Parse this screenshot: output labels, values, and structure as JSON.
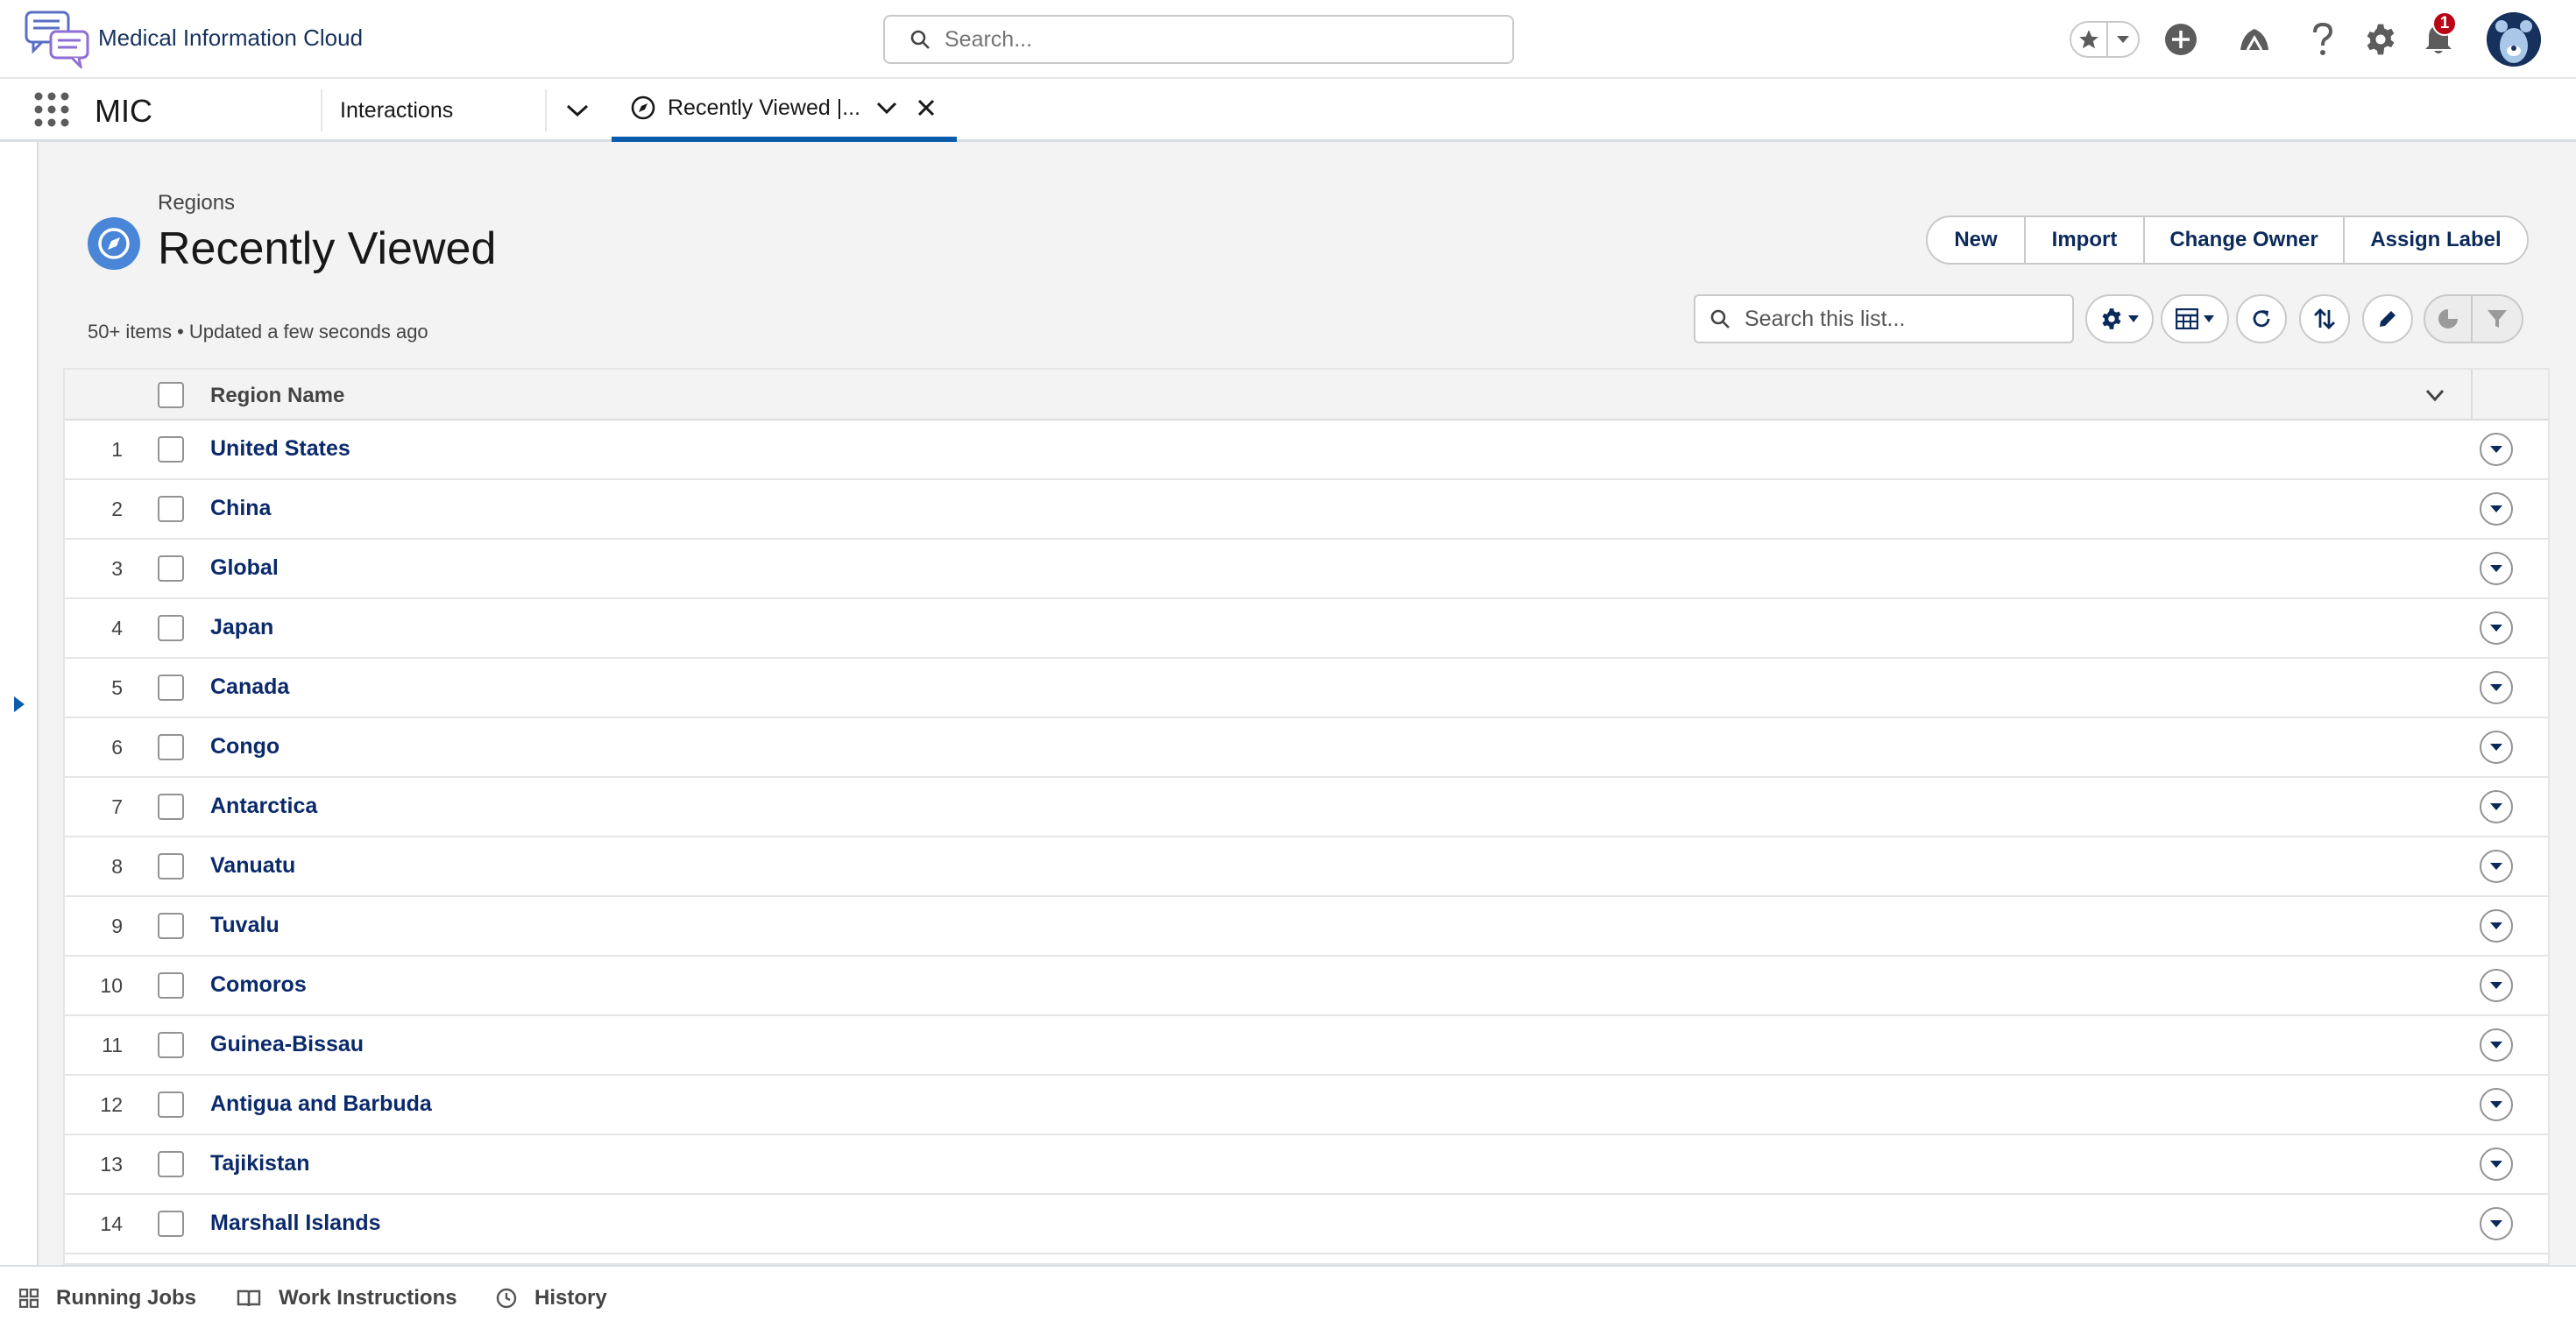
{
  "header": {
    "app_brand": "Medical Information Cloud",
    "search_placeholder": "Search...",
    "notification_count": "1"
  },
  "nav": {
    "app_name": "MIC",
    "tabs": [
      {
        "label": "Interactions"
      },
      {
        "label": "Recently Viewed |..."
      }
    ]
  },
  "list": {
    "object_label": "Regions",
    "title": "Recently Viewed",
    "meta": "50+ items • Updated a few seconds ago",
    "buttons": [
      "New",
      "Import",
      "Change Owner",
      "Assign Label"
    ],
    "search_placeholder": "Search this list...",
    "column_header": "Region Name",
    "rows": [
      {
        "num": "1",
        "name": "United States"
      },
      {
        "num": "2",
        "name": "China"
      },
      {
        "num": "3",
        "name": "Global"
      },
      {
        "num": "4",
        "name": "Japan"
      },
      {
        "num": "5",
        "name": "Canada"
      },
      {
        "num": "6",
        "name": "Congo"
      },
      {
        "num": "7",
        "name": "Antarctica"
      },
      {
        "num": "8",
        "name": "Vanuatu"
      },
      {
        "num": "9",
        "name": "Tuvalu"
      },
      {
        "num": "10",
        "name": "Comoros"
      },
      {
        "num": "11",
        "name": "Guinea-Bissau"
      },
      {
        "num": "12",
        "name": "Antigua and Barbuda"
      },
      {
        "num": "13",
        "name": "Tajikistan"
      },
      {
        "num": "14",
        "name": "Marshall Islands"
      }
    ]
  },
  "utility_bar": {
    "items": [
      "Running Jobs",
      "Work Instructions",
      "History"
    ]
  },
  "colors": {
    "brand_blue": "#0b5cab",
    "list_icon": "#4986d8",
    "link": "#0b2a6b",
    "badge": "#ba0517"
  },
  "icons": [
    "chat-logo-icon",
    "search-icon",
    "star-icon",
    "chevron-down-icon",
    "add-icon",
    "trailhead-icon",
    "help-icon",
    "gear-icon",
    "bell-icon",
    "avatar-icon",
    "app-launcher-icon",
    "compass-icon",
    "close-icon",
    "table-icon",
    "refresh-icon",
    "sort-icon",
    "pencil-icon",
    "chart-icon",
    "filter-icon",
    "caret-right-icon",
    "jobs-icon",
    "book-icon",
    "clock-icon"
  ]
}
